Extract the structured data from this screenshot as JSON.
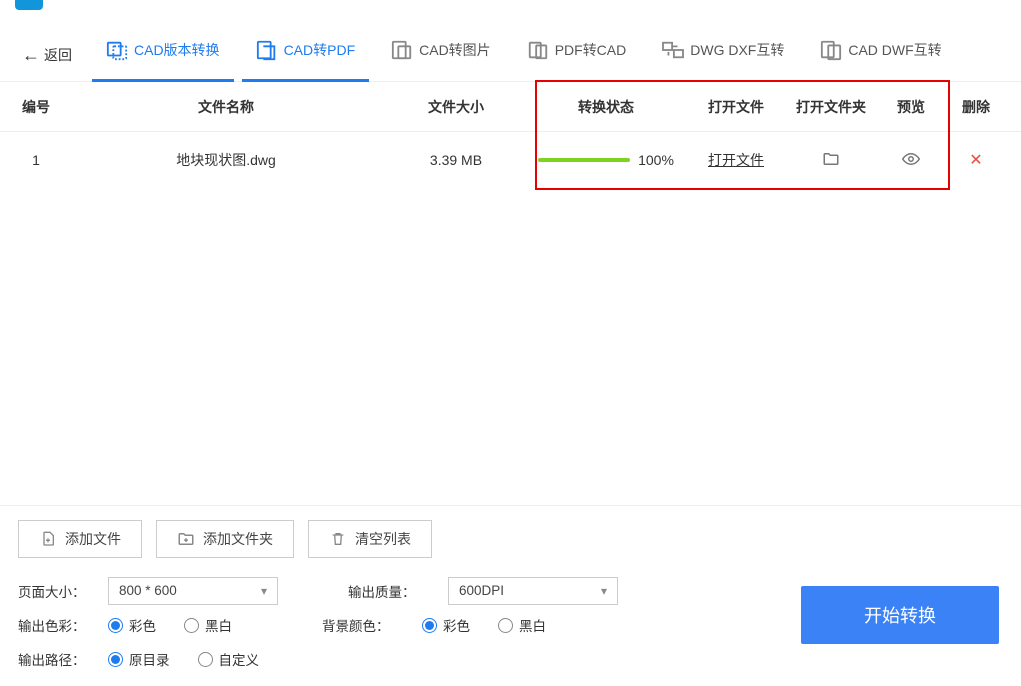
{
  "nav": {
    "back": "返回",
    "tabs": [
      {
        "label": "CAD版本转换",
        "active": true
      },
      {
        "label": "CAD转PDF",
        "active": true
      },
      {
        "label": "CAD转图片",
        "active": false
      },
      {
        "label": "PDF转CAD",
        "active": false
      },
      {
        "label": "DWG DXF互转",
        "active": false
      },
      {
        "label": "CAD DWF互转",
        "active": false
      }
    ]
  },
  "table": {
    "headers": {
      "id": "编号",
      "name": "文件名称",
      "size": "文件大小",
      "status": "转换状态",
      "open": "打开文件",
      "folder": "打开文件夹",
      "preview": "预览",
      "delete": "删除"
    },
    "rows": [
      {
        "id": "1",
        "name": "地块现状图.dwg",
        "size": "3.39 MB",
        "progress_pct": "100%",
        "open_label": "打开文件"
      }
    ]
  },
  "bottom": {
    "add_file": "添加文件",
    "add_folder": "添加文件夹",
    "clear_list": "清空列表",
    "page_size_label": "页面大小：",
    "page_size_value": "800 * 600",
    "output_quality_label": "输出质量：",
    "output_quality_value": "600DPI",
    "output_color_label": "输出色彩：",
    "color_option": "彩色",
    "bw_option": "黑白",
    "bg_color_label": "背景颜色：",
    "output_path_label": "输出路径：",
    "orig_dir": "原目录",
    "custom_dir": "自定义",
    "start_convert": "开始转换"
  },
  "colors": {
    "accent": "#1e7cf0",
    "progress": "#7ed321",
    "danger": "#e74c3c",
    "highlight_box": "#e60000"
  }
}
